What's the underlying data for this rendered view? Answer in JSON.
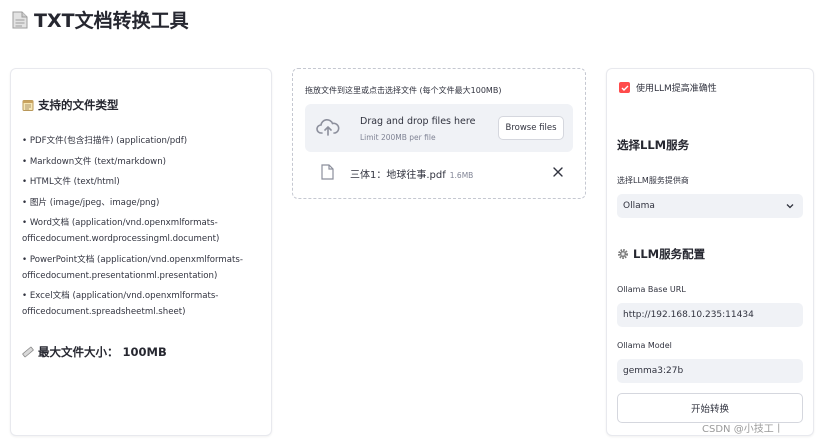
{
  "header": {
    "title": "TXT文档转换工具",
    "icon": "document-icon"
  },
  "left_panel": {
    "types_heading": "支持的文件类型",
    "types": [
      "PDF文件(包含扫描件) (application/pdf)",
      "Markdown文件 (text/markdown)",
      "HTML文件 (text/html)",
      "图片 (image/jpeg、image/png)",
      "Word文档 (application/vnd.openxmlformats-officedocument.wordprocessingml.document)",
      "PowerPoint文档 (application/vnd.openxmlformats-officedocument.presentationml.presentation)",
      "Excel文档 (application/vnd.openxmlformats-officedocument.spreadsheetml.sheet)"
    ],
    "max_size_heading": "最大文件大小： 100MB"
  },
  "uploader": {
    "hint": "拖放文件到这里或点击选择文件 (每个文件最大100MB)",
    "drop_title": "Drag and drop files here",
    "limit": "Limit 200MB per file",
    "browse_label": "Browse files",
    "file": {
      "name": "三体1：地球往事.pdf",
      "size": "1.6MB"
    }
  },
  "right_panel": {
    "checkbox_label": "使用LLM提高准确性",
    "checkbox_checked": true,
    "llm_heading": "选择LLM服务",
    "provider_label": "选择LLM服务提供商",
    "provider_value": "Ollama",
    "config_heading": "LLM服务配置",
    "base_url_label": "Ollama Base URL",
    "base_url_value": "http://192.168.10.235:11434",
    "model_label": "Ollama Model",
    "model_value": "gemma3:27b",
    "start_label": "开始转换"
  },
  "watermark": "CSDN @小技工丨",
  "colors": {
    "accent": "#ff4b4b",
    "input_bg": "#f0f2f6",
    "text": "#31333f"
  }
}
